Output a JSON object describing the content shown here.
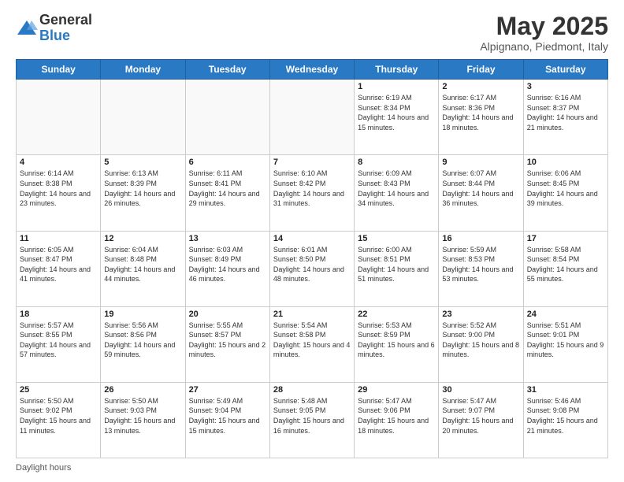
{
  "logo": {
    "general": "General",
    "blue": "Blue"
  },
  "title": "May 2025",
  "subtitle": "Alpignano, Piedmont, Italy",
  "days_header": [
    "Sunday",
    "Monday",
    "Tuesday",
    "Wednesday",
    "Thursday",
    "Friday",
    "Saturday"
  ],
  "footer": "Daylight hours",
  "weeks": [
    [
      {
        "day": "",
        "info": ""
      },
      {
        "day": "",
        "info": ""
      },
      {
        "day": "",
        "info": ""
      },
      {
        "day": "",
        "info": ""
      },
      {
        "day": "1",
        "info": "Sunrise: 6:19 AM\nSunset: 8:34 PM\nDaylight: 14 hours and 15 minutes."
      },
      {
        "day": "2",
        "info": "Sunrise: 6:17 AM\nSunset: 8:36 PM\nDaylight: 14 hours and 18 minutes."
      },
      {
        "day": "3",
        "info": "Sunrise: 6:16 AM\nSunset: 8:37 PM\nDaylight: 14 hours and 21 minutes."
      }
    ],
    [
      {
        "day": "4",
        "info": "Sunrise: 6:14 AM\nSunset: 8:38 PM\nDaylight: 14 hours and 23 minutes."
      },
      {
        "day": "5",
        "info": "Sunrise: 6:13 AM\nSunset: 8:39 PM\nDaylight: 14 hours and 26 minutes."
      },
      {
        "day": "6",
        "info": "Sunrise: 6:11 AM\nSunset: 8:41 PM\nDaylight: 14 hours and 29 minutes."
      },
      {
        "day": "7",
        "info": "Sunrise: 6:10 AM\nSunset: 8:42 PM\nDaylight: 14 hours and 31 minutes."
      },
      {
        "day": "8",
        "info": "Sunrise: 6:09 AM\nSunset: 8:43 PM\nDaylight: 14 hours and 34 minutes."
      },
      {
        "day": "9",
        "info": "Sunrise: 6:07 AM\nSunset: 8:44 PM\nDaylight: 14 hours and 36 minutes."
      },
      {
        "day": "10",
        "info": "Sunrise: 6:06 AM\nSunset: 8:45 PM\nDaylight: 14 hours and 39 minutes."
      }
    ],
    [
      {
        "day": "11",
        "info": "Sunrise: 6:05 AM\nSunset: 8:47 PM\nDaylight: 14 hours and 41 minutes."
      },
      {
        "day": "12",
        "info": "Sunrise: 6:04 AM\nSunset: 8:48 PM\nDaylight: 14 hours and 44 minutes."
      },
      {
        "day": "13",
        "info": "Sunrise: 6:03 AM\nSunset: 8:49 PM\nDaylight: 14 hours and 46 minutes."
      },
      {
        "day": "14",
        "info": "Sunrise: 6:01 AM\nSunset: 8:50 PM\nDaylight: 14 hours and 48 minutes."
      },
      {
        "day": "15",
        "info": "Sunrise: 6:00 AM\nSunset: 8:51 PM\nDaylight: 14 hours and 51 minutes."
      },
      {
        "day": "16",
        "info": "Sunrise: 5:59 AM\nSunset: 8:53 PM\nDaylight: 14 hours and 53 minutes."
      },
      {
        "day": "17",
        "info": "Sunrise: 5:58 AM\nSunset: 8:54 PM\nDaylight: 14 hours and 55 minutes."
      }
    ],
    [
      {
        "day": "18",
        "info": "Sunrise: 5:57 AM\nSunset: 8:55 PM\nDaylight: 14 hours and 57 minutes."
      },
      {
        "day": "19",
        "info": "Sunrise: 5:56 AM\nSunset: 8:56 PM\nDaylight: 14 hours and 59 minutes."
      },
      {
        "day": "20",
        "info": "Sunrise: 5:55 AM\nSunset: 8:57 PM\nDaylight: 15 hours and 2 minutes."
      },
      {
        "day": "21",
        "info": "Sunrise: 5:54 AM\nSunset: 8:58 PM\nDaylight: 15 hours and 4 minutes."
      },
      {
        "day": "22",
        "info": "Sunrise: 5:53 AM\nSunset: 8:59 PM\nDaylight: 15 hours and 6 minutes."
      },
      {
        "day": "23",
        "info": "Sunrise: 5:52 AM\nSunset: 9:00 PM\nDaylight: 15 hours and 8 minutes."
      },
      {
        "day": "24",
        "info": "Sunrise: 5:51 AM\nSunset: 9:01 PM\nDaylight: 15 hours and 9 minutes."
      }
    ],
    [
      {
        "day": "25",
        "info": "Sunrise: 5:50 AM\nSunset: 9:02 PM\nDaylight: 15 hours and 11 minutes."
      },
      {
        "day": "26",
        "info": "Sunrise: 5:50 AM\nSunset: 9:03 PM\nDaylight: 15 hours and 13 minutes."
      },
      {
        "day": "27",
        "info": "Sunrise: 5:49 AM\nSunset: 9:04 PM\nDaylight: 15 hours and 15 minutes."
      },
      {
        "day": "28",
        "info": "Sunrise: 5:48 AM\nSunset: 9:05 PM\nDaylight: 15 hours and 16 minutes."
      },
      {
        "day": "29",
        "info": "Sunrise: 5:47 AM\nSunset: 9:06 PM\nDaylight: 15 hours and 18 minutes."
      },
      {
        "day": "30",
        "info": "Sunrise: 5:47 AM\nSunset: 9:07 PM\nDaylight: 15 hours and 20 minutes."
      },
      {
        "day": "31",
        "info": "Sunrise: 5:46 AM\nSunset: 9:08 PM\nDaylight: 15 hours and 21 minutes."
      }
    ]
  ]
}
